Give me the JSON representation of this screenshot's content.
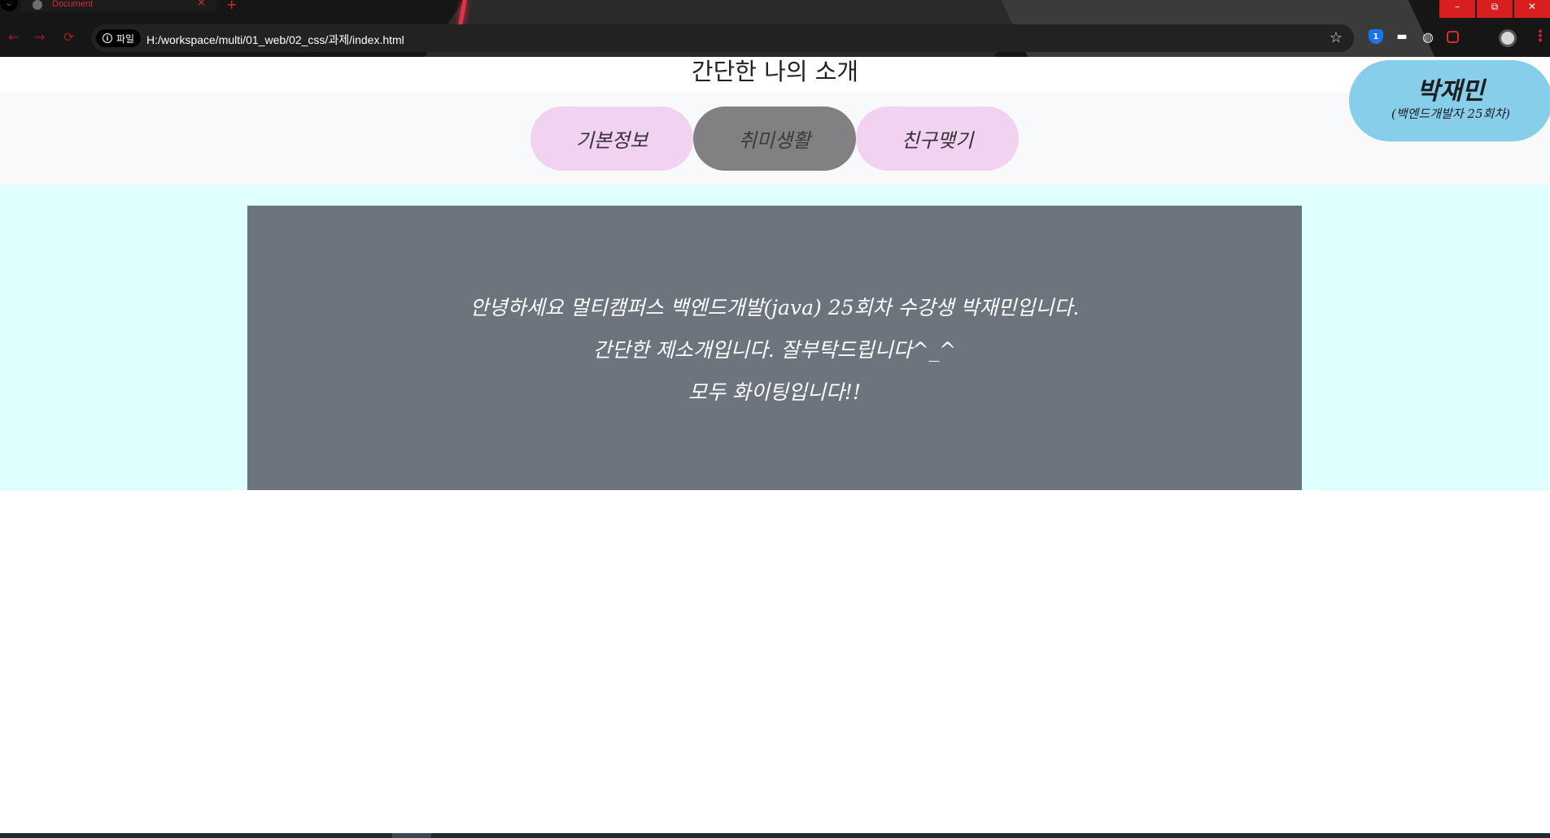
{
  "browser": {
    "tab_title": "Document",
    "tab_close": "×",
    "new_tab": "+",
    "window_controls": {
      "minimize": "–",
      "restore": "⧉",
      "close": "✕"
    },
    "security_label": "파일",
    "url": "H:/workspace/multi/01_web/02_css/과제/index.html",
    "bookmark_icon": "☆",
    "extension_1_label": "1"
  },
  "page": {
    "title": "간단한 나의 소개",
    "nav_items": [
      {
        "label": "기본정보",
        "active": false
      },
      {
        "label": "취미생활",
        "active": true
      },
      {
        "label": "친구맺기",
        "active": false
      }
    ],
    "profile": {
      "name": "박재민",
      "subtitle": "(백엔드개발자 25회차)"
    },
    "intro": {
      "line1": "안녕하세요 멀티캠퍼스 백엔드개발(java) 25회차 수강생 박재민입니다.",
      "line2": "간단한 제소개입니다. 잘부탁드립니다^_^",
      "line3": "모두 화이팅입니다!!"
    }
  },
  "colors": {
    "nav_band": "#f8f9fa",
    "pill": "#f1d2f1",
    "pill_active": "#828082",
    "profile_badge": "#87ceeb",
    "cyan_band": "#e0ffff",
    "intro_box": "#6c757d"
  }
}
